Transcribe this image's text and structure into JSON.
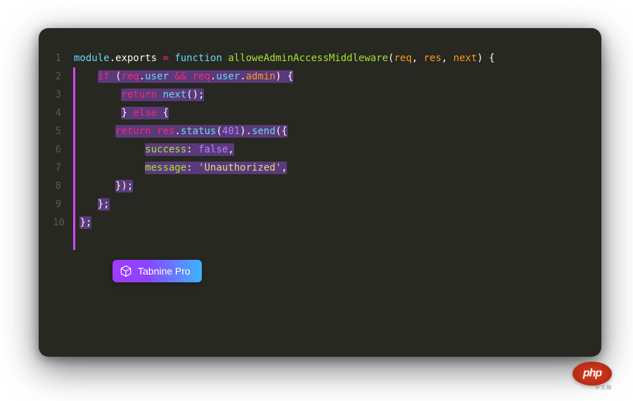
{
  "lineNumbers": [
    "1",
    "2",
    "3",
    "4",
    "5",
    "6",
    "7",
    "8",
    "9",
    "10"
  ],
  "code": {
    "l1": {
      "kw_module": "module",
      "dot1": ".",
      "exports": "exports",
      "eq": " = ",
      "kw_function": "function",
      "sp": " ",
      "fname": "alloweAdminAccessMiddleware",
      "paren_o": "(",
      "p1": "req",
      "c1": ", ",
      "p2": "res",
      "c2": ", ",
      "p3": "next",
      "paren_c": ")",
      "brace": " {"
    },
    "l2": {
      "kw_if": "if",
      "paren_o": " (",
      "req1": "req",
      "dot1": ".",
      "user1": "user",
      "and": " && ",
      "req2": "req",
      "dot2": ".",
      "user2": "user",
      "dot3": ".",
      "admin": "admin",
      "close": ") {"
    },
    "l3": {
      "kw_return": "return",
      "sp": " ",
      "next": "next",
      "call": "();"
    },
    "l4": {
      "close": "}",
      "kw_else": " else ",
      "open": "{"
    },
    "l5": {
      "kw_return": "return",
      "sp": " ",
      "res": "res",
      "dot1": ".",
      "status": "status",
      "po": "(",
      "code": "401",
      "pc": ")",
      "dot2": ".",
      "send": "send",
      "open": "({"
    },
    "l6": {
      "key": "success",
      "colon": ": ",
      "val": "false",
      "comma": ","
    },
    "l7": {
      "key": "message",
      "colon": ": ",
      "val": "'Unauthorized'",
      "comma": ","
    },
    "l8": {
      "close": "});"
    },
    "l9": {
      "close": "};"
    },
    "l10": {
      "close": "};"
    }
  },
  "badge": {
    "label": "Tabnine Pro"
  },
  "watermark": {
    "text": "php",
    "sub": "中文网"
  }
}
